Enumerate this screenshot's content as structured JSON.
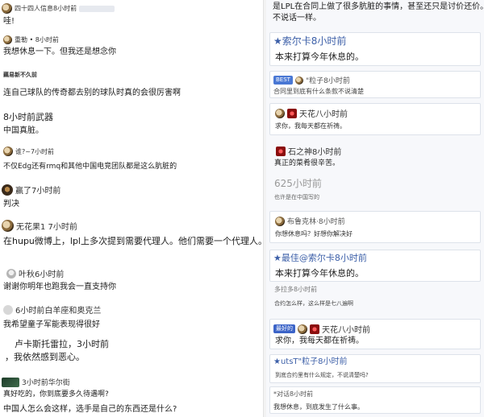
{
  "left": {
    "comments": [
      {
        "head": "四十四人信息8小时前",
        "body": "哇!",
        "avatar": "dog-icon"
      },
      {
        "head": "重勒 • 8小时前",
        "body": "我想休息一下。但我还是想念你",
        "avatar": "dog-icon"
      },
      {
        "head": "藕易新不久前",
        "body": "连自己球队的传奇都去别的球队时真的会很厉害啊",
        "avatar": ""
      },
      {
        "head": "8小时前武器",
        "body": "中国真脏。",
        "avatar": ""
      },
      {
        "head": "谁?~7小时前",
        "body": "不仅Edg还有rmq和其他中国电竞团队都是这么肮脏的",
        "avatar": "dog-icon"
      },
      {
        "head": "赢了7小时前",
        "body": "判决",
        "avatar": "dog-icon"
      },
      {
        "head": "无花果1 7小时前",
        "body": "在hupu微博上，lpl上多次提到需要代理人。他们需要一个代理人。",
        "avatar": "dog-icon"
      },
      {
        "head": "叶秋6小时前",
        "body": "谢谢你明年也跑我会一直支持你",
        "avatar": "light-icon"
      },
      {
        "head": "6小时前白羊座和奥克兰",
        "body": "我希望童子军能表现得很好",
        "avatar": "grey-icon"
      },
      {
        "head": "卢卡斯托雷拉，3小时前",
        "body": "，我依然感到恶心。",
        "avatar": ""
      },
      {
        "head": "3小时前华尔街",
        "body": "真好吃的，你到底要多久待遇啊?",
        "avatar": "green-icon"
      },
      {
        "head": "",
        "body": "中国人怎么会这样，选手是自己的东西还是什么?",
        "avatar": ""
      }
    ]
  },
  "right": {
    "top_text": "是LPL在合同上做了很多肮脏的事情，甚至还只是讨价还价。",
    "top_text2": "不说话一样。",
    "items": [
      {
        "head": "★索尔卡8小时前",
        "body": "本来打算今年休息的。"
      },
      {
        "head": "\"粒子8小时前",
        "body": "合同里到底有什么条款不说清楚",
        "tag": "BEST"
      },
      {
        "head": "天花八小时前",
        "body": "求你，我每天都在祈祷。"
      },
      {
        "head": "石之神8小时前",
        "body": "真正的菜肴很辛苦。"
      },
      {
        "head": "625小时前",
        "body": "也许是在中国写的"
      },
      {
        "head": "布鲁克林·8小时前",
        "body": "你想休息吗？好想你解决好"
      },
      {
        "head": "★最佳@索尔卡8小时前",
        "body": "本来打算今年休息的。"
      },
      {
        "head": "多拉多8小时前",
        "body": "合约怎么样，这么样是七八遍啊"
      },
      {
        "head": "天花八小时前",
        "body": "求你，我每天都在祈祷。",
        "tag": "最好的"
      },
      {
        "head": "★utsT\"粒子8小时前",
        "body": "到底合约里有什么规定，不说清楚吗?"
      },
      {
        "head": "*对话8小时前",
        "body": "我想休息，到底发生了什么事。"
      }
    ]
  }
}
